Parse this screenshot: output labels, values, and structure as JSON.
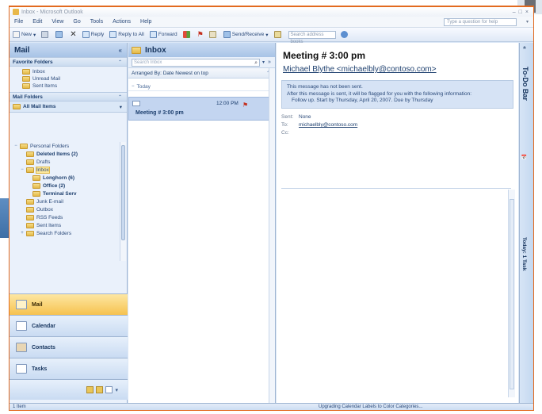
{
  "window": {
    "title": "Inbox - Microsoft Outlook"
  },
  "menu": [
    "File",
    "Edit",
    "View",
    "Go",
    "Tools",
    "Actions",
    "Help"
  ],
  "ask_box": "Type a question for help",
  "toolbar": {
    "new": "New",
    "reply": "Reply",
    "reply_all": "Reply to All",
    "forward": "Forward",
    "send_receive": "Send/Receive",
    "search_address": "Search address books"
  },
  "nav": {
    "title": "Mail",
    "favorites_header": "Favorite Folders",
    "favorites": [
      "Inbox",
      "Unread Mail",
      "Sent Items"
    ],
    "mail_folders_header": "Mail Folders",
    "all_mail_items": "All Mail Items",
    "tree": [
      {
        "label": "Personal Folders",
        "level": 1,
        "bold": false,
        "exp": "−"
      },
      {
        "label": "Deleted Items (2)",
        "level": 2,
        "bold": true,
        "exp": ""
      },
      {
        "label": "Drafts",
        "level": 2,
        "bold": false,
        "exp": ""
      },
      {
        "label": "Inbox",
        "level": 2,
        "bold": false,
        "exp": "−",
        "selected": true
      },
      {
        "label": "Longhorn (6)",
        "level": 3,
        "bold": true,
        "exp": ""
      },
      {
        "label": "Office (2)",
        "level": 3,
        "bold": true,
        "exp": ""
      },
      {
        "label": "Terminal Serv",
        "level": 3,
        "bold": true,
        "exp": ""
      },
      {
        "label": "Junk E-mail",
        "level": 2,
        "bold": false,
        "exp": ""
      },
      {
        "label": "Outbox",
        "level": 2,
        "bold": false,
        "exp": ""
      },
      {
        "label": "RSS Feeds",
        "level": 2,
        "bold": false,
        "exp": ""
      },
      {
        "label": "Sent Items",
        "level": 2,
        "bold": false,
        "exp": ""
      },
      {
        "label": "Search Folders",
        "level": 2,
        "bold": false,
        "exp": "+"
      }
    ],
    "buttons": [
      "Mail",
      "Calendar",
      "Contacts",
      "Tasks"
    ]
  },
  "list": {
    "title": "Inbox",
    "search_placeholder": "Search Inbox",
    "arranged_by": "Arranged By: Date  Newest on top",
    "group": "Today",
    "message": {
      "time": "12:00 PM",
      "subject": "Meeting # 3:00 pm"
    }
  },
  "reading": {
    "subject": "Meeting # 3:00 pm",
    "from": "Michael Blythe <michaelbly@contoso.com>",
    "info_lines": [
      "This message has not been sent.",
      "After this message is sent, it will be flagged for you with the following information:",
      "Follow up.  Start by Thursday, April 20, 2007.  Due by Thursday"
    ],
    "sent_label": "Sent:",
    "sent_value": "None",
    "to_label": "To:",
    "to_value": "michaelbly@contoso.com",
    "cc_label": "Cc:"
  },
  "todo": {
    "title": "To-Do Bar",
    "calendar_label": "(calendar)",
    "tasks_label": "Today: 1 Task"
  },
  "status": {
    "left": "1 Item",
    "right": "Upgrading Calendar Labels to Color Categories..."
  },
  "colors": {
    "accent_border": "#e26a1f",
    "active_nav": "#f6c24f",
    "selected_row": "#c3d5f0"
  }
}
